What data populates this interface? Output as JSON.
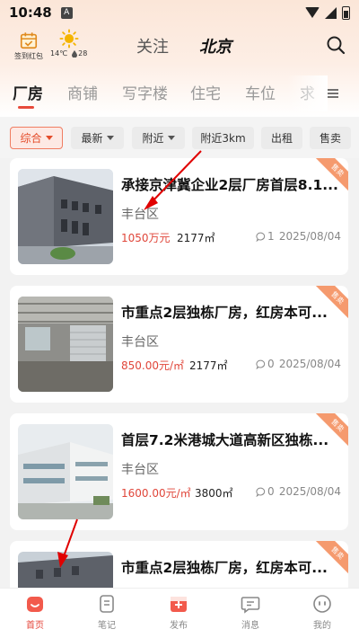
{
  "status_bar": {
    "time": "10:48",
    "badge": "A"
  },
  "header": {
    "checkin_label": "签到红包",
    "weather_temp": "14℃",
    "weather_aqi": "28",
    "follow_tab": "关注",
    "city_tab": "北京"
  },
  "categories": [
    "厂房",
    "商铺",
    "写字楼",
    "住宅",
    "车位",
    "求"
  ],
  "filters": [
    "综合",
    "最新",
    "附近",
    "附近3km",
    "出租",
    "售卖"
  ],
  "listings": [
    {
      "title": "承接京津冀企业2层厂房首层8.1...",
      "district": "丰台区",
      "price": "1050万元",
      "area": "2177㎡",
      "comments": "1",
      "date": "2025/08/04",
      "ribbon": "售卖"
    },
    {
      "title": "市重点2层独栋厂房，红房本可...",
      "district": "丰台区",
      "price": "850.00元/㎡",
      "area": "2177㎡",
      "comments": "0",
      "date": "2025/08/04",
      "ribbon": "售卖"
    },
    {
      "title": "首层7.2米港城大道高新区独栋...",
      "district": "丰台区",
      "price": "1600.00元/㎡",
      "area": "3800㎡",
      "comments": "0",
      "date": "2025/08/04",
      "ribbon": "售卖"
    },
    {
      "title": "市重点2层独栋厂房，红房本可...",
      "ribbon": "售卖"
    }
  ],
  "bottom_nav": [
    "首页",
    "笔记",
    "发布",
    "消息",
    "我的"
  ],
  "colors": {
    "accent": "#e5453a",
    "price": "#e0463a",
    "ribbon": "#f59a6e"
  }
}
